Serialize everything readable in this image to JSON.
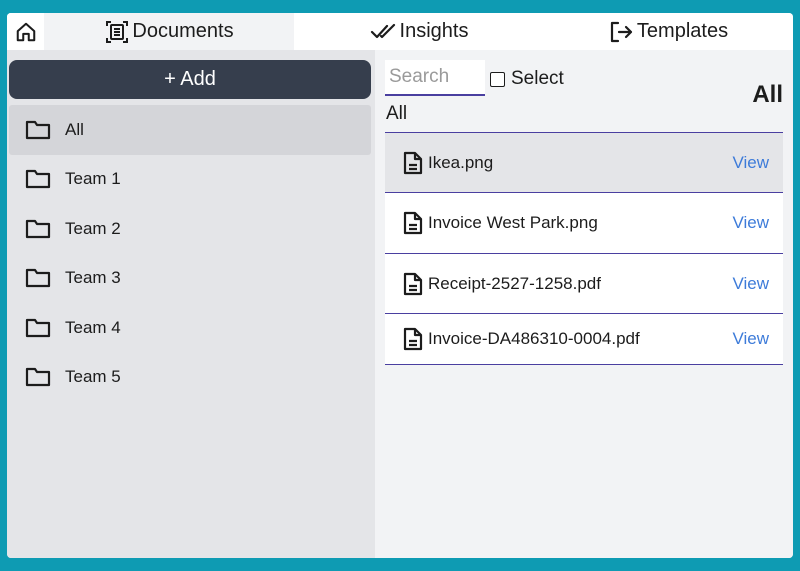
{
  "nav": {
    "home_icon": "home-icon",
    "tabs": [
      {
        "label": "Documents",
        "icon": "document-scan-icon",
        "active": true
      },
      {
        "label": "Insights",
        "icon": "double-check-icon",
        "active": false
      },
      {
        "label": "Templates",
        "icon": "export-icon",
        "active": false
      }
    ]
  },
  "sidebar": {
    "add_label": "+ Add",
    "folders": [
      {
        "label": "All",
        "selected": true
      },
      {
        "label": "Team 1"
      },
      {
        "label": "Team 2"
      },
      {
        "label": "Team 3"
      },
      {
        "label": "Team 4"
      },
      {
        "label": "Team 5"
      }
    ]
  },
  "main": {
    "search_placeholder": "Search",
    "select_label": "Select",
    "filter_label": "All",
    "heading": "All",
    "documents": [
      {
        "name": "Ikea.png",
        "action": "View",
        "highlight": true
      },
      {
        "name": "Invoice West Park.png",
        "action": "View"
      },
      {
        "name": "Receipt-2527-1258.pdf",
        "action": "View"
      },
      {
        "name": "Invoice-DA486310-0004.pdf",
        "action": "View"
      }
    ]
  },
  "colors": {
    "frame": "#0e9bb3",
    "add_button": "#363e4d",
    "accent_line": "#4a3fa0",
    "link": "#3d7bd9"
  }
}
